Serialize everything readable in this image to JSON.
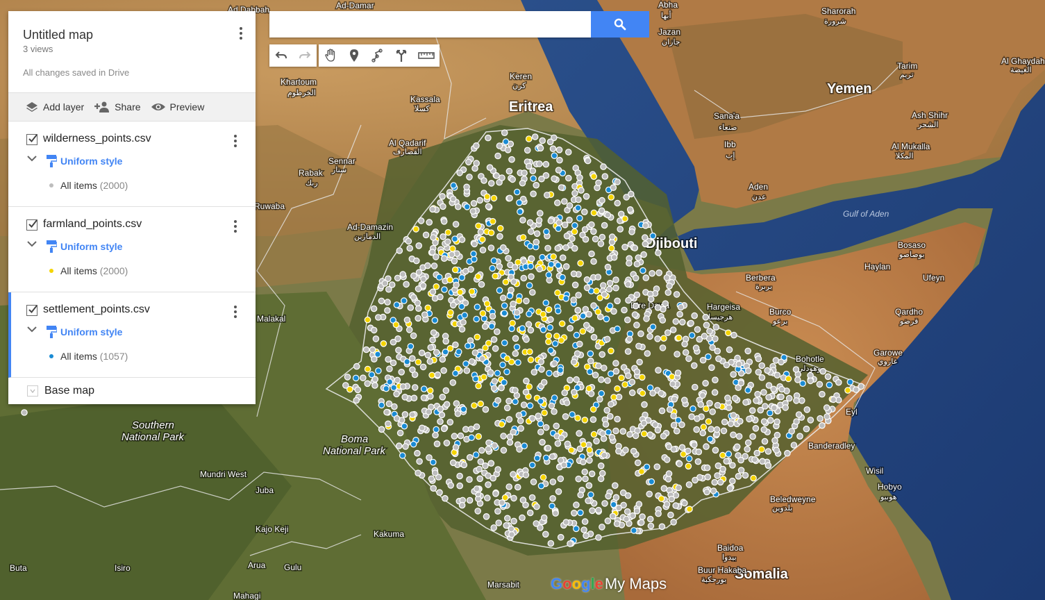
{
  "map": {
    "country_labels": [
      "Eritrea",
      "Yemen",
      "Djibouti",
      "Somalia"
    ],
    "city_labels": [
      "Ad-Damar",
      "Ad Dabbah",
      "Abha",
      "Jazan",
      "Sharorah",
      "Al Ghaydah",
      "Khartoum",
      "Keren",
      "Kassala",
      "Tarim",
      "Ash Shihr",
      "Al Mukalla",
      "Sana'a",
      "Ibb",
      "Al Qadarif",
      "Sennar",
      "Rabak",
      "Aden",
      "Ad-Damazin",
      "Berbera",
      "Bosaso",
      "Baylan",
      "Ufeyn",
      "Malakal",
      "Hargeisa",
      "Burco",
      "Qardho",
      "Garowe",
      "Bohotle",
      "Eyl",
      "Banderadley",
      "Wisil",
      "Hobyo",
      "Beledweyne",
      "Baidoa",
      "Buur Hakaba",
      "Juba",
      "Kajo Keji",
      "Mundri West",
      "Kakuma",
      "Marsabit",
      "Buta",
      "Isiro",
      "Arua",
      "Gulu",
      "Mahagi",
      "Ruwaba",
      "Dire Dawa"
    ],
    "arabic_labels": [
      "أبها",
      "جازان",
      "شرورة",
      "الغيضة",
      "الخرطوم",
      "كرن",
      "كسلا",
      "تريم",
      "الشحر",
      "المكلا",
      "صنعاء",
      "إب",
      "القضارف",
      "سنار",
      "ربك",
      "عدن",
      "الدمازين",
      "بربرة",
      "بوصاصو",
      "قرضو",
      "غاروي",
      "بوهودلي",
      "هرجيسا",
      "برعو",
      "بلدوين",
      "بيدوا",
      "بورحكبة",
      "هوبيو"
    ],
    "park_labels": [
      "Southern National Park",
      "Boma National Park"
    ],
    "gulf_label": "Gulf of Aden",
    "layer_colors": {
      "wilderness": "#bdbdbd",
      "farmland": "#f4d400",
      "settlement": "#1a8bd4"
    },
    "point_counts": {
      "wilderness": 2000,
      "farmland": 2000,
      "settlement": 1057
    }
  },
  "search": {
    "placeholder": "",
    "value": ""
  },
  "toolbar": [
    "undo-icon",
    "redo-icon",
    "hand-icon",
    "marker-icon",
    "draw-line-icon",
    "directions-icon",
    "ruler-icon"
  ],
  "panel": {
    "title": "Untitled map",
    "views": "3 views",
    "saved": "All changes saved in Drive",
    "actions": {
      "add_layer": "Add layer",
      "share": "Share",
      "preview": "Preview"
    },
    "layers": [
      {
        "name": "wilderness_points.csv",
        "style": "Uniform style",
        "items_label": "All items",
        "count": "(2000)",
        "dot_color": "#bdbdbd"
      },
      {
        "name": "farmland_points.csv",
        "style": "Uniform style",
        "items_label": "All items",
        "count": "(2000)",
        "dot_color": "#f4d400"
      },
      {
        "name": "settlement_points.csv",
        "style": "Uniform style",
        "items_label": "All items",
        "count": "(1057)",
        "dot_color": "#1a8bd4"
      }
    ],
    "base_map": "Base map"
  },
  "logo": {
    "google": "Google",
    "my_maps": "My Maps"
  }
}
